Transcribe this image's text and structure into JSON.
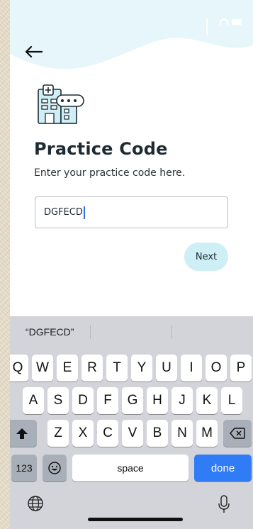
{
  "screen": {
    "title": "Practice Code",
    "subtitle": "Enter your practice code here.",
    "input_value": "DGFECD",
    "next_label": "Next",
    "back_icon": "arrow-left-icon",
    "illustration_icon": "hospital-password-icon"
  },
  "keyboard": {
    "suggestion": "“DGFECD”",
    "row1": [
      "Q",
      "W",
      "E",
      "R",
      "T",
      "Y",
      "U",
      "I",
      "O",
      "P"
    ],
    "row2": [
      "A",
      "S",
      "D",
      "F",
      "G",
      "H",
      "J",
      "K",
      "L"
    ],
    "row3": [
      "Z",
      "X",
      "C",
      "V",
      "B",
      "N",
      "M"
    ],
    "numbers_label": "123",
    "space_label": "space",
    "done_label": "done",
    "shift_icon": "shift-icon",
    "backspace_icon": "backspace-icon",
    "emoji_icon": "emoji-icon",
    "globe_icon": "globe-icon",
    "mic_icon": "microphone-icon"
  },
  "colors": {
    "accent_light": "#cdeff5",
    "wave": "#e6f6fa",
    "title": "#1f2b33",
    "done_key": "#2f7cf6"
  }
}
